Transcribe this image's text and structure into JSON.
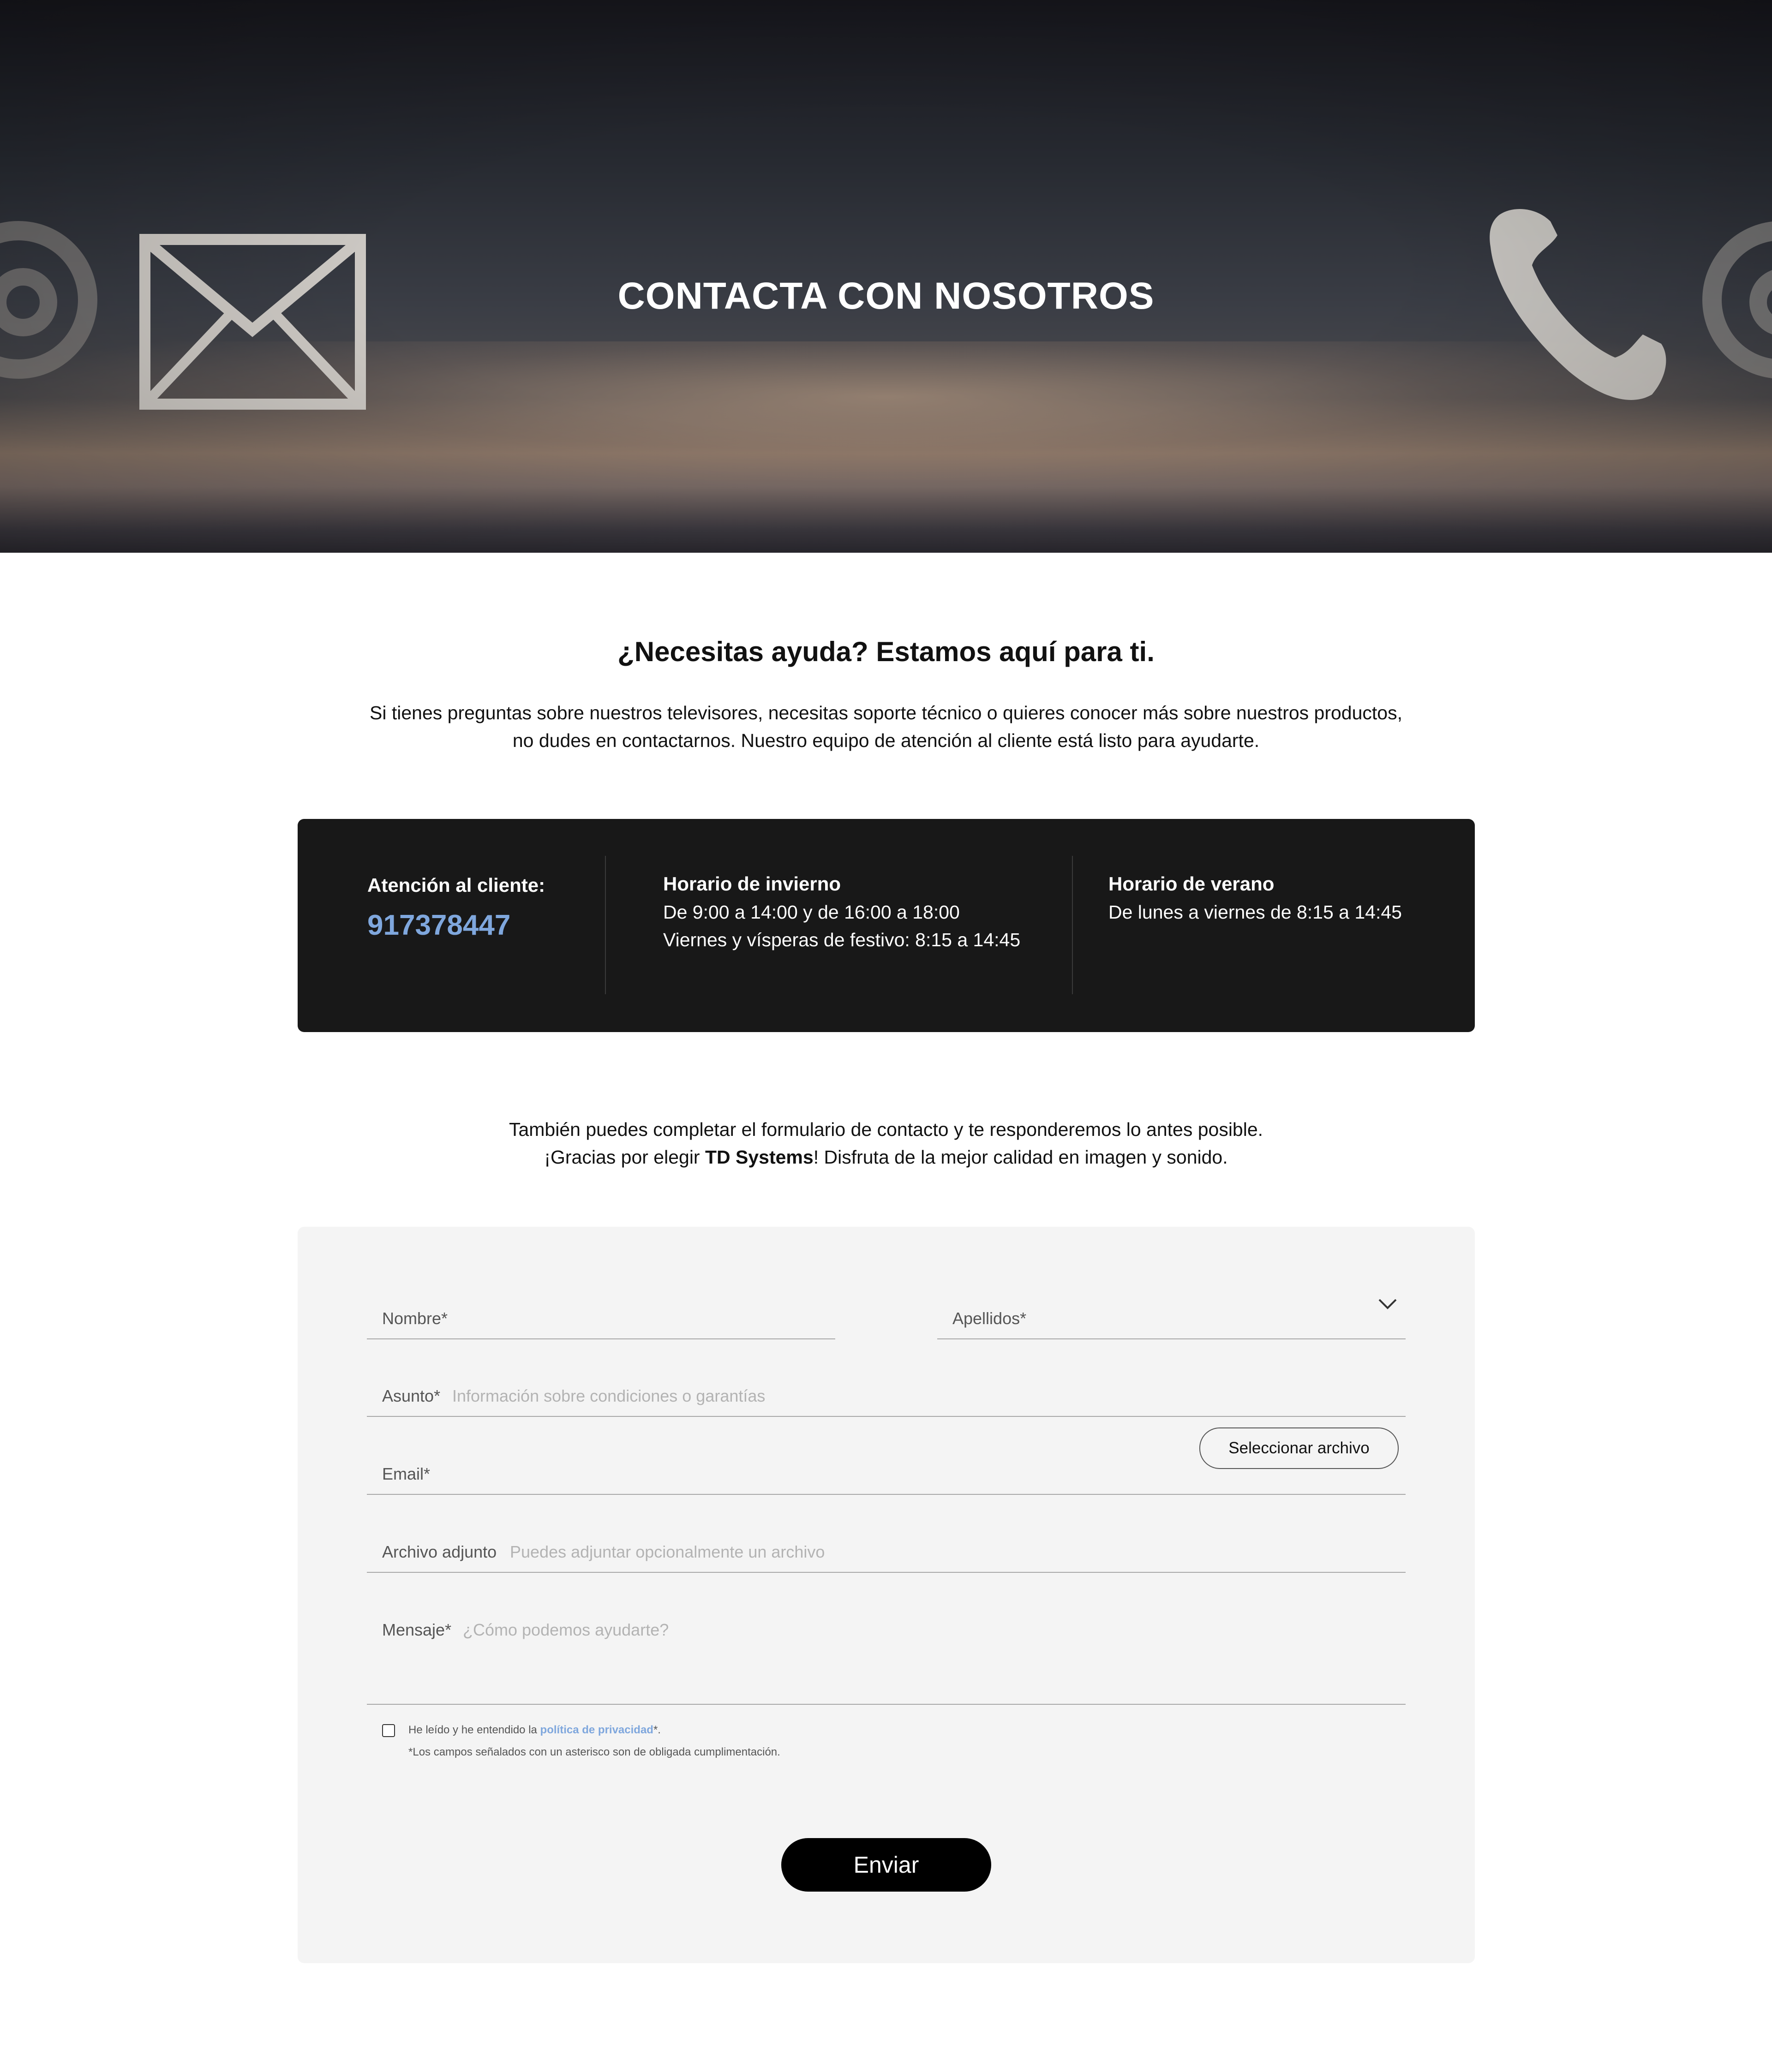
{
  "hero": {
    "title": "CONTACTA CON NOSOTROS",
    "decor_icons": [
      "at-sign-icon",
      "envelope-icon",
      "phone-icon",
      "at-sign-icon"
    ]
  },
  "intro": {
    "title": "¿Necesitas ayuda? Estamos aquí para ti.",
    "line1": "Si tienes preguntas sobre nuestros televisores, necesitas soporte técnico o quieres conocer más sobre nuestros productos,",
    "line2": "no dudes en contactarnos. Nuestro equipo de atención al cliente está listo para ayudarte."
  },
  "info": {
    "customer_label": "Atención al cliente:",
    "phone": "917378447",
    "winter_label": "Horario de invierno",
    "winter_line1": "De 9:00 a 14:00 y de 16:00 a 18:00",
    "winter_line2": "Viernes y vísperas de festivo: 8:15 a 14:45",
    "summer_label": "Horario de verano",
    "summer_line1": "De lunes a viernes de 8:15 a 14:45"
  },
  "secondary": {
    "line1": "También puedes completar el formulario de contacto y te responderemos lo antes posible.",
    "line2_prefix": "¡Gracias por elegir ",
    "brand": "TD  Systems",
    "line2_suffix": "! Disfruta de la mejor calidad en imagen y sonido."
  },
  "form": {
    "nombre_label": "Nombre*",
    "apellidos_label": "Apellidos*",
    "asunto_label": "Asunto*",
    "asunto_placeholder": "Información sobre condiciones o garantías",
    "email_label": "Email*",
    "file_button": "Seleccionar archivo",
    "archivo_label": "Archivo adjunto",
    "archivo_placeholder": "Puedes adjuntar opcionalmente un archivo",
    "mensaje_label": "Mensaje*",
    "mensaje_placeholder": "¿Cómo podemos ayudarte?",
    "privacy_prefix": "He leído y he entendido la ",
    "privacy_link": "política de privacidad",
    "privacy_suffix": "*.",
    "required_note": "*Los campos señalados con un asterisco son de obligada cumplimentación.",
    "privacy_checked": false,
    "submit": "Enviar"
  },
  "colors": {
    "accent_blue": "#7fa7dd",
    "info_bg": "#181818",
    "form_bg": "#f4f4f4",
    "button_bg": "#000000"
  }
}
